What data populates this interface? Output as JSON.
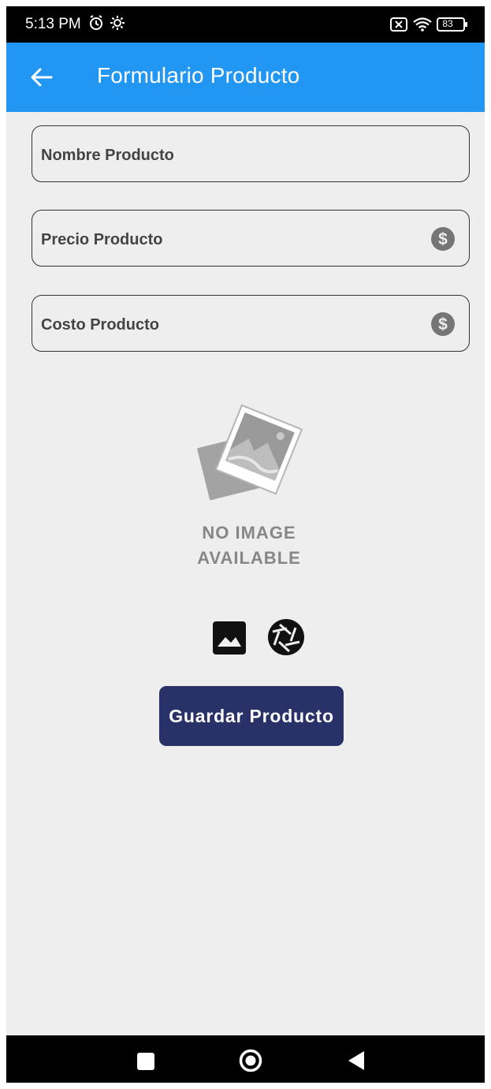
{
  "status_bar": {
    "time": "5:13 PM",
    "battery": "83",
    "icons": [
      "alarm-icon",
      "settings-icon",
      "sim-off-icon",
      "wifi-icon",
      "battery-icon"
    ]
  },
  "app_bar": {
    "title": "Formulario Producto",
    "back_icon": "arrow-left-icon",
    "color": "#2196f3"
  },
  "form": {
    "fields": [
      {
        "label": "Nombre Producto",
        "trailing_icon": null
      },
      {
        "label": "Precio Producto",
        "trailing_icon": "dollar-circle-icon"
      },
      {
        "label": "Costo Producto",
        "trailing_icon": "dollar-circle-icon"
      }
    ]
  },
  "image_preview": {
    "line1": "NO IMAGE",
    "line2": "AVAILABLE"
  },
  "image_actions": [
    "gallery-icon",
    "camera-shutter-icon"
  ],
  "save_button": {
    "label": "Guardar Producto",
    "color": "#283269"
  },
  "nav_bar": [
    "recents-icon",
    "home-icon",
    "back-icon"
  ]
}
